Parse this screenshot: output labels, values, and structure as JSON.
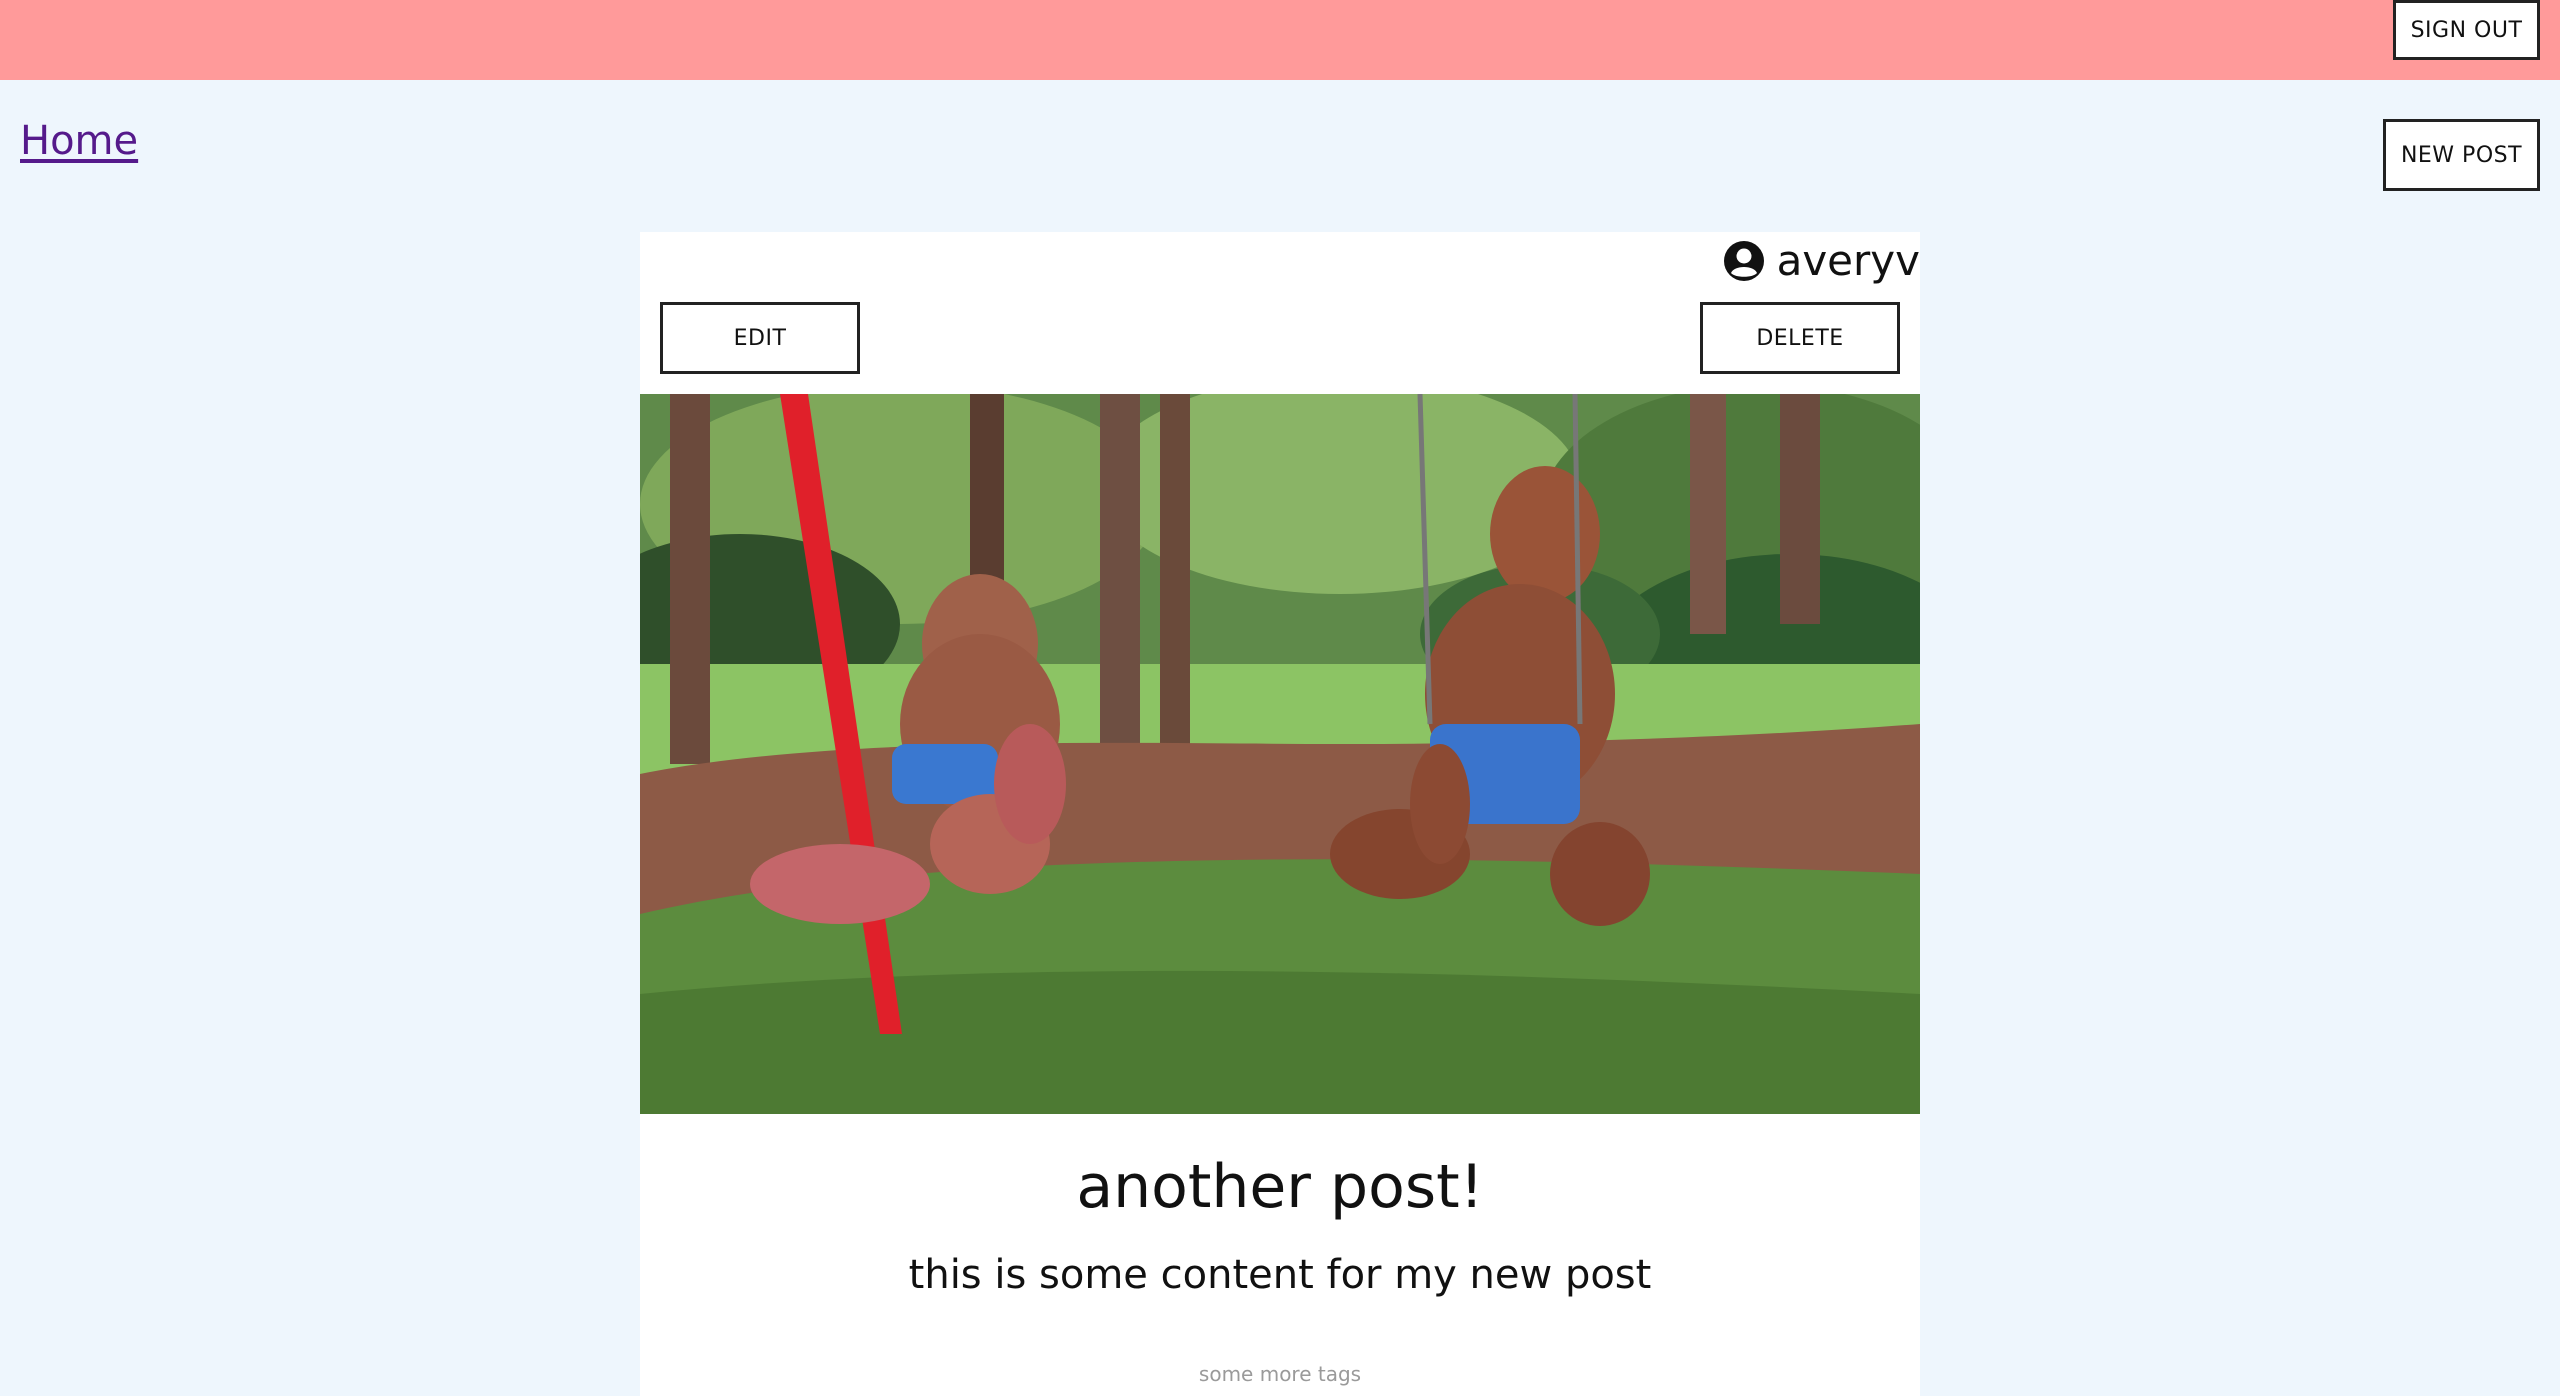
{
  "header": {
    "sign_out_label": "SIGN OUT"
  },
  "nav": {
    "home_label": "Home",
    "new_post_label": "NEW POST"
  },
  "post": {
    "author": "averyv",
    "edit_label": "EDIT",
    "delete_label": "DELETE",
    "image_subject": "two poodles on swings in a park",
    "title": "another post!",
    "content": "this is some content for my new post",
    "tags": "some more tags"
  },
  "colors": {
    "header_bg": "#ff9a9a",
    "page_bg": "#eef6fd",
    "link": "#551a8b"
  }
}
